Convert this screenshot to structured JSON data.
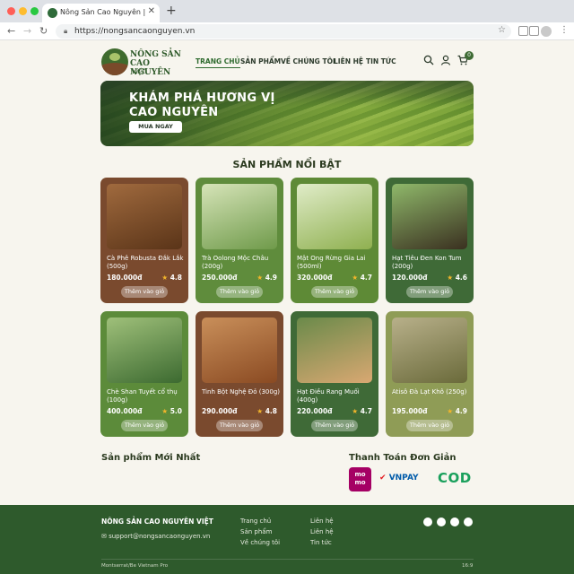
{
  "browser": {
    "tab_title": "Nông Sản Cao Nguyên | Cửa",
    "url": "https://nongsancaonguyen.vn"
  },
  "header": {
    "logo_line1": "NÔNG SẢN",
    "logo_line2": "CAO NGUYÊN",
    "logo_line3": "Việt",
    "nav": [
      "TRANG CHỦ",
      "SẢN PHẨM",
      "VỀ CHÚNG TÔI",
      "LIÊN HỆ",
      "TIN TỨC"
    ],
    "cart_count": "0"
  },
  "hero": {
    "title_line1": "KHÁM PHÁ HƯƠNG VỊ",
    "title_line2": "CAO NGUYÊN",
    "cta": "MUA NGAY"
  },
  "featured": {
    "title": "SẢN PHẨM NỔI BẬT",
    "button_label": "Thêm vào giỏ",
    "products": [
      {
        "name": "Cà Phê Robusta Đắk Lắk (500g)",
        "price": "180.000đ",
        "rating": "4.8",
        "color": "#7a4a2e",
        "icon": "coffee-bag"
      },
      {
        "name": "Trà Oolong Mộc Châu (200g)",
        "price": "250.000đ",
        "rating": "4.9",
        "color": "#5f8c3c",
        "icon": "tea-pack"
      },
      {
        "name": "Mật Ong Rừng Gia Lai (500ml)",
        "price": "320.000đ",
        "rating": "4.7",
        "color": "#5e8a36",
        "icon": "honey-jar"
      },
      {
        "name": "Hạt Tiêu Đen Kon Tum (200g)",
        "price": "120.000đ",
        "rating": "4.6",
        "color": "#3f6a37",
        "icon": "pepper-bowl"
      },
      {
        "name": "Chè Shan Tuyết cổ thụ (100g)",
        "price": "400.000đ",
        "rating": "5.0",
        "color": "#5c8b3a",
        "icon": "tea-box"
      },
      {
        "name": "Tinh Bột Nghệ Đỏ (300g)",
        "price": "290.000đ",
        "rating": "4.8",
        "color": "#7a4a2e",
        "icon": "turmeric-pack"
      },
      {
        "name": "Hạt Điều Rang Muối (400g)",
        "price": "220.000đ",
        "rating": "4.7",
        "color": "#3f6a37",
        "icon": "cashew-bowl"
      },
      {
        "name": "Atisô Đà Lạt Khô (250g)",
        "price": "195.000đ",
        "rating": "4.9",
        "color": "#8f9c56",
        "icon": "artichoke-basket"
      }
    ]
  },
  "newest": {
    "title": "Sản phẩm Mới Nhất"
  },
  "payment": {
    "title": "Thanh Toán Đơn Giản",
    "momo_line1": "mo",
    "momo_line2": "mo",
    "vnpay": "VNPAY",
    "cod": "COD"
  },
  "footer": {
    "brand": "NÔNG SẢN CAO NGUYÊN VIỆT",
    "email": "support@nongsancaonguyen.vn",
    "col1": [
      "Trang chủ",
      "Sản phẩm",
      "Về chúng tôi"
    ],
    "col2": [
      "Liên hệ",
      "Liên hệ",
      "Tin tức"
    ],
    "fonts_note": "Montserrat/Be Vietnam Pro",
    "ratio": "16:9"
  },
  "colors": {
    "brand_green": "#2f5a2a",
    "footer_green": "#2e5a2c",
    "star": "#f2b52b"
  }
}
